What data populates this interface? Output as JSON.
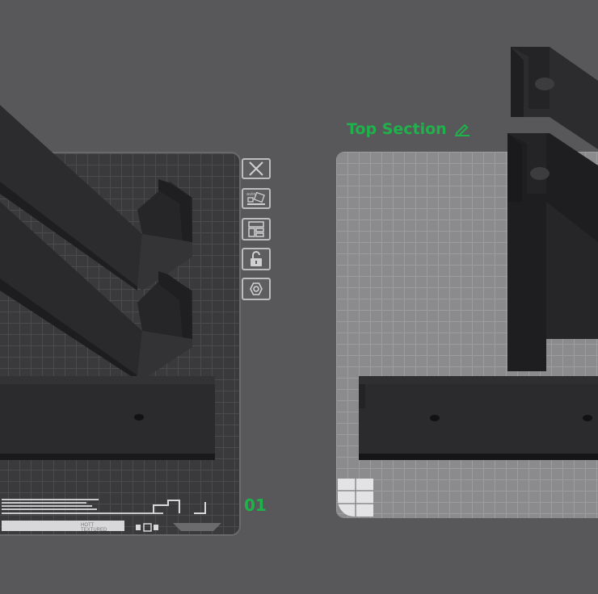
{
  "plates": {
    "left": {
      "number": "01"
    },
    "right": {
      "title": "Top Section"
    }
  },
  "plate_label": {
    "line1": "HOTT",
    "line2": "TEXTURED"
  },
  "toolbar": {
    "items": [
      {
        "name": "close-plate",
        "icon": "close-icon"
      },
      {
        "name": "auto-arrange",
        "icon": "auto-arrange-icon"
      },
      {
        "name": "plate-layout",
        "icon": "layout-icon"
      },
      {
        "name": "lock-plate",
        "icon": "unlock-icon"
      },
      {
        "name": "plate-settings",
        "icon": "settings-icon"
      }
    ]
  },
  "colors": {
    "accent": "#1fb24a",
    "background": "#58585a",
    "plate_dark": "#3a3a3c",
    "plate_light": "#8b8b8e",
    "part": "#2a2a2c"
  }
}
